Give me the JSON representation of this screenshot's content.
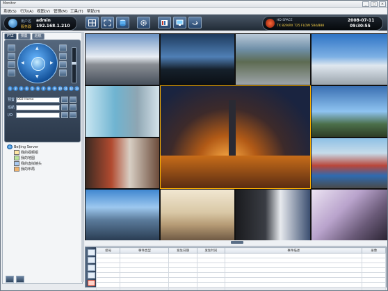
{
  "window": {
    "title": "Monitor",
    "controls": [
      "_",
      "□",
      "×"
    ]
  },
  "menu": [
    "系统(S)",
    "行为(A)",
    "视图(V)",
    "管理(M)",
    "工具(T)",
    "帮助(H)"
  ],
  "user": {
    "username_label": "用户名",
    "username": "admin",
    "server_label": "服务器",
    "server": "192.168.1.210"
  },
  "toolbar": {
    "icons": [
      "layout-grid-icon",
      "fullscreen-icon",
      "database-icon",
      "settings-icon",
      "record-icon",
      "monitor-icon",
      "return-icon"
    ]
  },
  "status": {
    "line1": "HD SPACE",
    "line2": "TX 829/RX 725 FLOW 584/888",
    "date": "2008-07-11",
    "time": "09:30:55"
  },
  "left_panel": {
    "tabs": [
      "PTZ",
      "预置",
      "巡航"
    ],
    "ptz_numbers": [
      "1",
      "2",
      "3",
      "4",
      "5",
      "6",
      "7",
      "8",
      "9",
      "10",
      "11",
      "12",
      "13"
    ],
    "fields": [
      {
        "label": "预置",
        "value": "002-Home"
      },
      {
        "label": "巡航",
        "value": ""
      },
      {
        "label": "I/O",
        "value": ""
      }
    ],
    "tree": [
      {
        "label": "BeiJing Server",
        "icon": "globe-icon"
      },
      {
        "label": "我的视频组",
        "icon": "camera-group-icon"
      },
      {
        "label": "我的地图",
        "icon": "map-icon"
      },
      {
        "label": "我的虚拟镜头",
        "icon": "virtual-camera-icon"
      },
      {
        "label": "我的布局",
        "icon": "layout-icon"
      }
    ]
  },
  "log_table": {
    "headers": [
      "组号",
      "事件类型",
      "发生日期",
      "发生时间",
      "事件描述",
      "录像"
    ],
    "rows": 10
  },
  "colors": {
    "header_dark": "#202a35",
    "selected_cell": "#ffb400",
    "accent_blue": "#1b5fa5"
  }
}
